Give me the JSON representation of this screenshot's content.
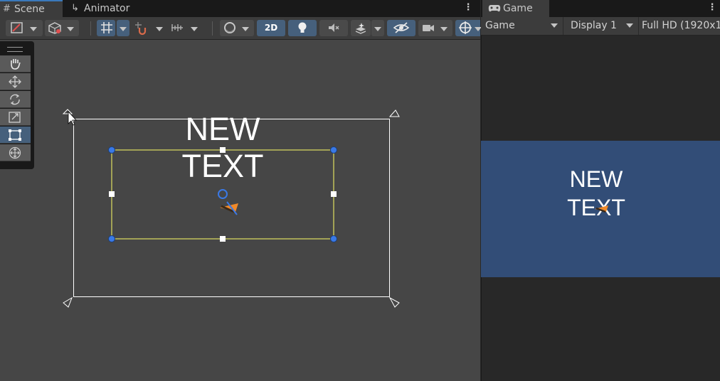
{
  "scene_tab": {
    "label": "Scene",
    "icon": "grid-icon"
  },
  "animator_tab": {
    "label": "Animator",
    "icon": "animator-icon"
  },
  "game_tab": {
    "label": "Game",
    "icon": "gamepad-icon"
  },
  "scene_toolbar": {
    "mode_2d_label": "2D"
  },
  "game_toolbar": {
    "view_select": "Game",
    "display_select": "Display 1",
    "resolution_select": "Full HD (1920x1"
  },
  "scene_content": {
    "text_line1": "NEW",
    "text_line2": "TEXT"
  },
  "game_content": {
    "text_line1": "NEW",
    "text_line2": "TEXT"
  },
  "colors": {
    "selection_yellow": "#ffff66",
    "handle_blue": "#3a79e6",
    "game_bg": "#324d77",
    "scene_bg": "#464646",
    "active_button": "#46607c"
  }
}
